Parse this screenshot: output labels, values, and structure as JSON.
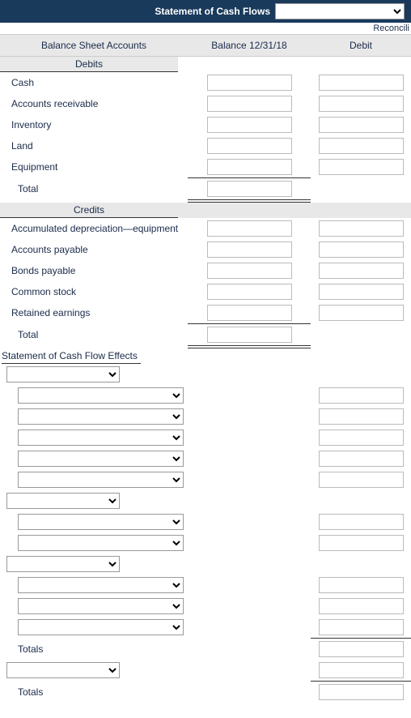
{
  "header": {
    "title": "Statement of Cash Flows"
  },
  "columns": {
    "c1": "Balance Sheet Accounts",
    "c2": "Balance 12/31/18",
    "c3": "Debit",
    "recon": "Reconcili"
  },
  "sections": {
    "debits": "Debits",
    "credits": "Credits"
  },
  "debit_accounts": [
    "Cash",
    "Accounts receivable",
    "Inventory",
    "Land",
    "Equipment"
  ],
  "credit_accounts": [
    "Accumulated depreciation—equipment",
    "Accounts payable",
    "Bonds payable",
    "Common stock",
    "Retained earnings"
  ],
  "labels": {
    "total": "Total",
    "totals": "Totals",
    "stmt_effects": "Statement of Cash Flow Effects"
  }
}
